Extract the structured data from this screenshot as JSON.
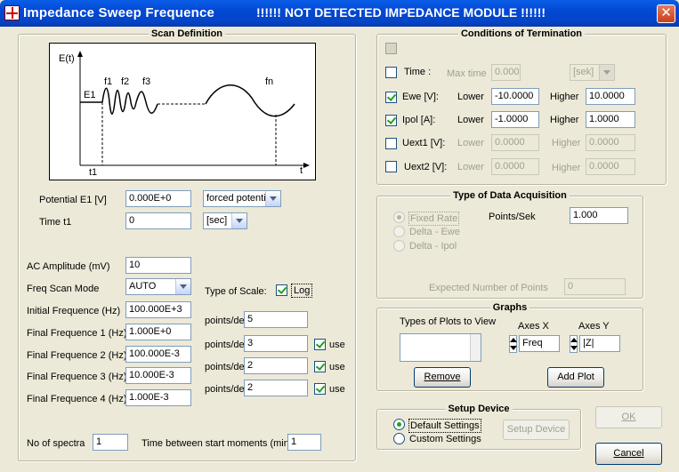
{
  "window": {
    "title": "Impedance Sweep Frequence",
    "warning": "!!!!!!  NOT DETECTED IMPEDANCE MODULE  !!!!!!",
    "close_label": "✕"
  },
  "scan": {
    "group_title": "Scan Definition",
    "diagram": {
      "y_label": "E(t)",
      "e1": "E1",
      "f1": "f1",
      "f2": "f2",
      "f3": "f3",
      "fn": "fn",
      "t1": "t1",
      "t": "t"
    },
    "potential_label": "Potential E1 [V]",
    "potential_value": "0.000E+0",
    "potential_mode": "forced potenti",
    "time_label": "Time  t1",
    "time_value": "0",
    "time_unit": "[sec]",
    "ac_label": "AC Amplitude (mV)",
    "ac_value": "10",
    "freq_mode_label": "Freq Scan Mode",
    "freq_mode_value": "AUTO",
    "scale_label": "Type of Scale:",
    "scale_log": "Log",
    "initial_label": "Initial Frequence (Hz)",
    "initial_value": "100.000E+3",
    "points_label": "points/dek:",
    "initial_points": "5",
    "final1_label": "Final Frequence 1 (Hz)",
    "final1_value": "1.000E+0",
    "final1_points": "3",
    "final2_label": "Final Frequence 2 (Hz)",
    "final2_value": "100.000E-3",
    "final2_points": "2",
    "final3_label": "Final Frequence 3 (Hz)",
    "final3_value": "10.000E-3",
    "final3_points": "2",
    "final4_label": "Final Frequence 4 (Hz)",
    "final4_value": "1.000E-3",
    "use_label": "use",
    "spectra_label": "No of spectra",
    "spectra_value": "1",
    "between_label": "Time between start moments (min)",
    "between_value": "1"
  },
  "term": {
    "group_title": "Conditions of Termination",
    "time_label": "Time :",
    "maxtime_label": "Max time",
    "maxtime_value": "0.000",
    "time_unit": "[sek]",
    "lower_label": "Lower",
    "higher_label": "Higher",
    "ewe_label": "Ewe [V]:",
    "ewe_lower": "-10.0000",
    "ewe_higher": "10.0000",
    "ipol_label": "Ipol [A]:",
    "ipol_lower": "-1.0000",
    "ipol_higher": "1.0000",
    "uext1_label": "Uext1 [V]:",
    "uext1_lower": "0.0000",
    "uext1_higher": "0.0000",
    "uext2_label": "Uext2 [V]:",
    "uext2_lower": "0.0000",
    "uext2_higher": "0.0000"
  },
  "acq": {
    "group_title": "Type of Data Acquisition",
    "fixed_rate": "Fixed Rate",
    "delta_ewe": "Delta - Ewe",
    "delta_ipol": "Delta - Ipol",
    "points_sek_label": "Points/Sek",
    "points_sek_value": "1.000",
    "expected_label": "Expected Number of Points",
    "expected_value": "0"
  },
  "graphs": {
    "group_title": "Graphs",
    "types_label": "Types of Plots to View",
    "axes_x_label": "Axes X",
    "axes_y_label": "Axes Y",
    "axes_x_value": "Freq",
    "axes_y_value": "|Z|",
    "remove_label": "Remove",
    "add_plot_label": "Add Plot"
  },
  "setup": {
    "group_title": "Setup Device",
    "default_label": "Default Settings",
    "custom_label": "Custom Settings",
    "setup_button": "Setup Device"
  },
  "buttons": {
    "ok": "OK",
    "cancel": "Cancel"
  }
}
